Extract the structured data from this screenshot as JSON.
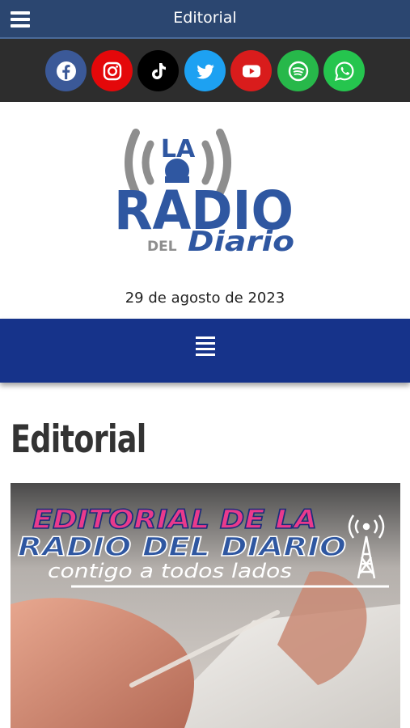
{
  "header": {
    "title": "Editorial"
  },
  "social": [
    {
      "name": "facebook",
      "color": "#3b5998"
    },
    {
      "name": "instagram",
      "color": "#e4080a"
    },
    {
      "name": "tiktok",
      "color": "#000000"
    },
    {
      "name": "twitter",
      "color": "#1da1f2"
    },
    {
      "name": "youtube",
      "color": "#d91c1c"
    },
    {
      "name": "spotify",
      "color": "#27b84a"
    },
    {
      "name": "whatsapp",
      "color": "#25c54e"
    }
  ],
  "logo": {
    "line1": "LA",
    "line2": "RADIO",
    "line3_small": "DEL",
    "line3": "Diario"
  },
  "date": "29 de agosto de 2023",
  "page": {
    "title": "Editorial"
  },
  "hero": {
    "line1": "EDITORIAL DE LA",
    "line2": "RADIO DEL DIARIO",
    "line3": "contigo a todos lados"
  },
  "colors": {
    "header": "#2b4670",
    "social_bar": "#2d2d2d",
    "nav": "#16338a",
    "logo_blue": "#2f57a1",
    "logo_gray": "#8e8e8e",
    "hero_pink": "#e93a8c"
  }
}
